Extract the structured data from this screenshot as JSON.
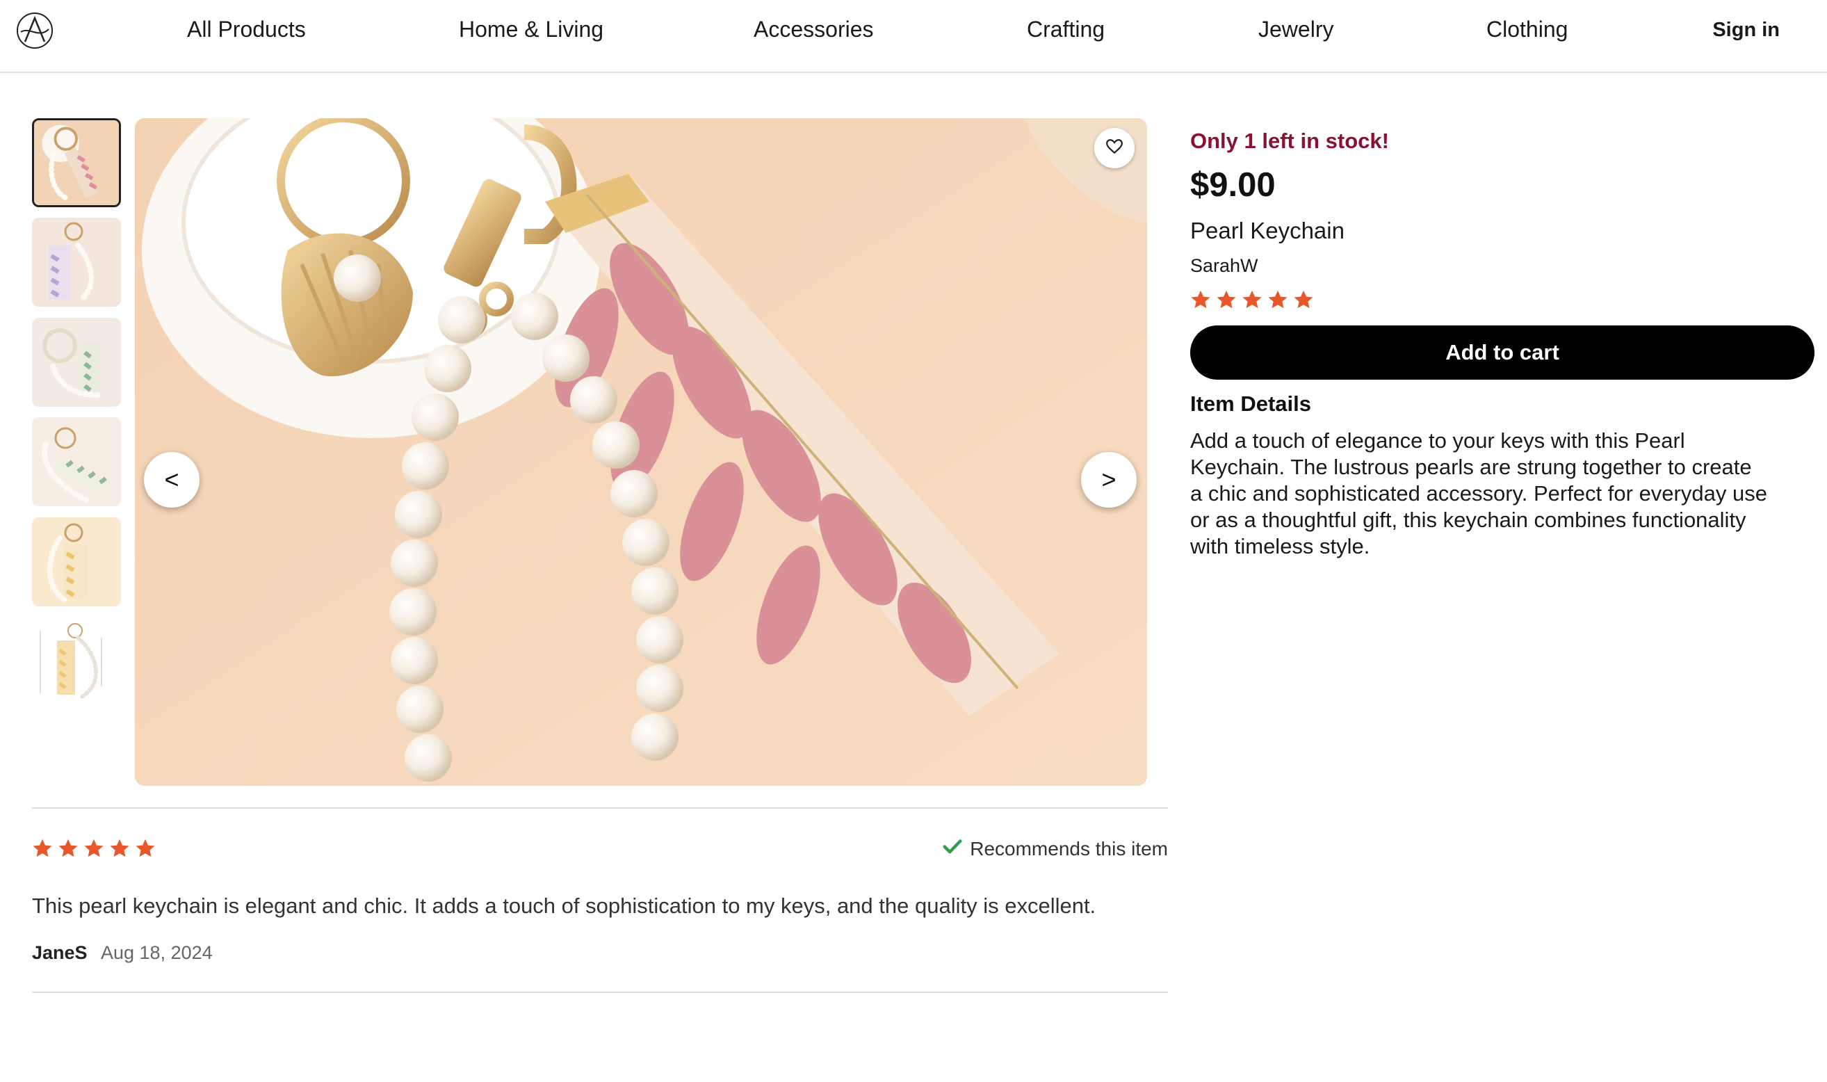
{
  "nav": {
    "logo_icon": "a-monogram-logo",
    "items": [
      "All Products",
      "Home & Living",
      "Accessories",
      "Crafting",
      "Jewelry",
      "Clothing"
    ],
    "sign_in": "Sign in"
  },
  "gallery": {
    "thumbnail_count": 6,
    "selected_index": 0,
    "prev_label": "<",
    "next_label": ">",
    "favorite_icon": "heart-icon"
  },
  "product": {
    "stock_notice": "Only 1 left in stock!",
    "price": "$9.00",
    "title": "Pearl Keychain",
    "seller": "SarahW",
    "rating": 5,
    "add_to_cart": "Add to cart",
    "details_heading": "Item Details",
    "details_text": "Add a touch of elegance to your keys with this Pearl Keychain. The lustrous pearls are strung together to create a chic and sophisticated accessory. Perfect for everyday use or as a thoughtful gift, this keychain combines functionality with timeless style."
  },
  "review": {
    "rating": 5,
    "recommends": "Recommends this item",
    "text": "This pearl keychain is elegant and chic. It adds a touch of sophistication to my keys, and the quality is excellent.",
    "author": "JaneS",
    "date": "Aug 18, 2024"
  },
  "colors": {
    "star": "#e8572a",
    "stock_text": "#8a1131",
    "cart_button": "#000000",
    "check": "#2e9e4f"
  }
}
